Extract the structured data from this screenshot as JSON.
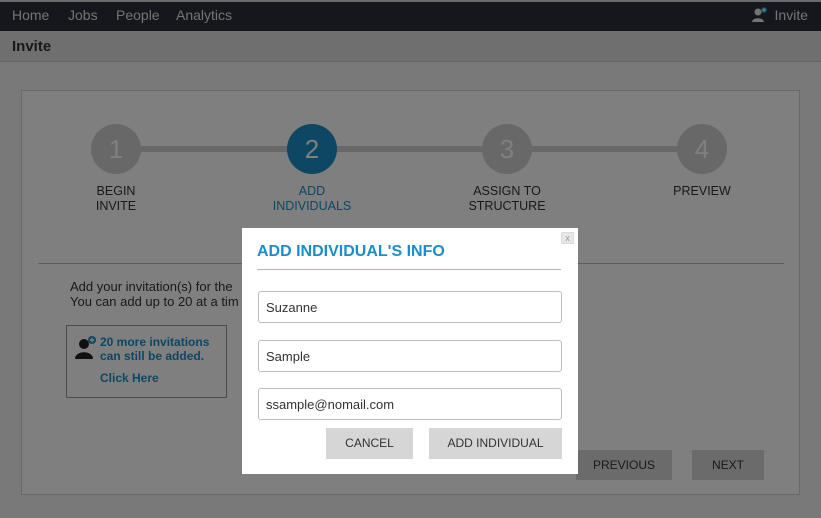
{
  "nav": {
    "items": [
      "Home",
      "Jobs",
      "People",
      "Analytics"
    ],
    "invite_label": "Invite"
  },
  "page_title": "Invite",
  "steps": [
    {
      "number": "1",
      "label_line1": "BEGIN",
      "label_line2": "INVITE",
      "active": false
    },
    {
      "number": "2",
      "label_line1": "ADD",
      "label_line2": "INDIVIDUALS",
      "active": true
    },
    {
      "number": "3",
      "label_line1": "ASSIGN TO",
      "label_line2": "STRUCTURE",
      "active": false
    },
    {
      "number": "4",
      "label_line1": "PREVIEW",
      "label_line2": "",
      "active": false
    }
  ],
  "intro": {
    "line1": "Add your invitation(s) for the",
    "line2": "You can add up to 20 at a tim"
  },
  "notice": {
    "count_text": "20 more invitations can still be added.",
    "link_text": "Click Here"
  },
  "footer_buttons": {
    "previous": "PREVIOUS",
    "next": "NEXT"
  },
  "modal": {
    "title": "ADD INDIVIDUAL'S INFO",
    "close_label": "x",
    "first_name": "Suzanne",
    "last_name": "Sample",
    "email": "ssample@nomail.com",
    "cancel_label": "CANCEL",
    "add_label": "ADD INDIVIDUAL"
  },
  "colors": {
    "accent": "#1a8ec9",
    "nav_bg": "#2b2f3a",
    "step_inactive": "#d1d1d1"
  }
}
